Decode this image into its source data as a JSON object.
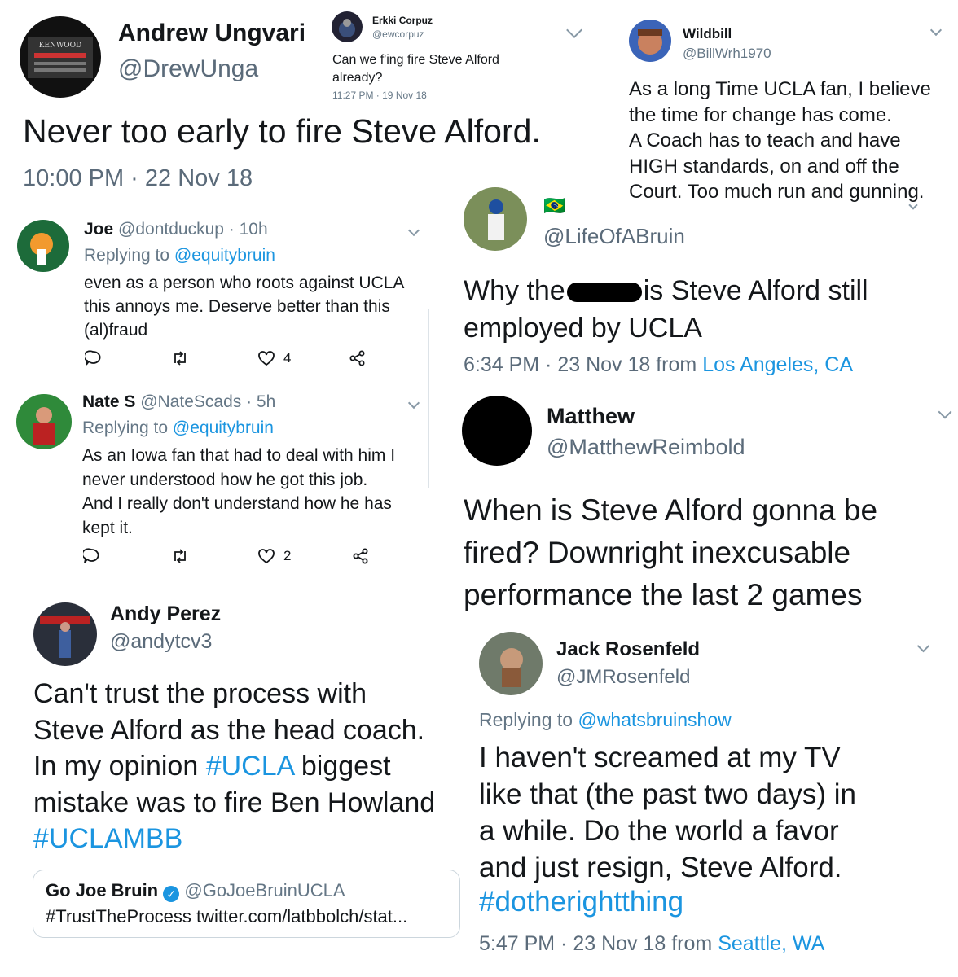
{
  "t1": {
    "name": "Andrew Ungvari",
    "handle": "@DrewUnga",
    "text": "Never too early to fire Steve Alford.",
    "time": "10:00 PM · 22 Nov 18",
    "avatar_text": "KENWOOD"
  },
  "t2": {
    "name": "Erkki Corpuz",
    "handle": "@ewcorpuz",
    "text": "Can we f'ing fire Steve Alford\nalready?",
    "time": "11:27 PM · 19 Nov 18"
  },
  "t3": {
    "name": "Wildbill",
    "handle": "@BillWrh1970",
    "text": "As a long Time UCLA fan, I believe\nthe time for change has come.\nA Coach has to teach and have\nHIGH standards, on and off the\nCourt. Too much run and gunning."
  },
  "r1": {
    "name": "Joe",
    "handle": "@dontduckup",
    "age": "· 10h",
    "reply_prefix": "Replying to",
    "reply_to": "@equitybruin",
    "text": "even as a person who roots against UCLA\nthis annoys me. Deserve better than this\n(al)fraud",
    "likes": "4"
  },
  "r2": {
    "name": "Nate S",
    "handle": "@NateScads",
    "age": "· 5h",
    "reply_prefix": "Replying to",
    "reply_to": "@equitybruin",
    "text": "As an Iowa fan that had to deal with him I\nnever understood how he got this job.\nAnd I really don't understand how he has\nkept it.",
    "likes": "2"
  },
  "t4": {
    "flag": "🇧🇷",
    "handle": "@LifeOfABruin",
    "text_a": "Why the",
    "text_b": "is Steve Alford still",
    "text_c": "employed by UCLA",
    "time": "6:34 PM · 23 Nov 18 from",
    "location": "Los Angeles, CA"
  },
  "t5": {
    "name": "Matthew",
    "handle": "@MatthewReimbold",
    "text": "When is Steve Alford gonna be\nfired? Downright inexcusable\nperformance the last 2 games"
  },
  "t6": {
    "name": "Andy Perez",
    "handle": "@andytcv3",
    "line1": "Can't trust the process with",
    "line2": "Steve Alford as the head coach.",
    "line3a": "In my opinion",
    "line3_tag": "#UCLA",
    "line3b": "biggest",
    "line4": "mistake was to fire Ben Howland",
    "line5_tag": "#UCLAMBB",
    "quote": {
      "name": "Go Joe Bruin",
      "handle": "@GoJoeBruinUCLA",
      "text": "#TrustTheProcess twitter.com/latbbolch/stat..."
    }
  },
  "t7": {
    "name": "Jack Rosenfeld",
    "handle": "@JMRosenfeld",
    "reply_prefix": "Replying to",
    "reply_to": "@whatsbruinshow",
    "text": "I haven't screamed at my TV\nlike that (the past two days) in\na while. Do the world a favor\nand just resign, Steve Alford.",
    "tag": "#dotherightthing",
    "time": "5:47 PM · 23 Nov 18 from",
    "location": "Seattle, WA"
  },
  "colors": {
    "link": "#1b95e0",
    "secondary": "#657786",
    "text": "#14171a"
  }
}
